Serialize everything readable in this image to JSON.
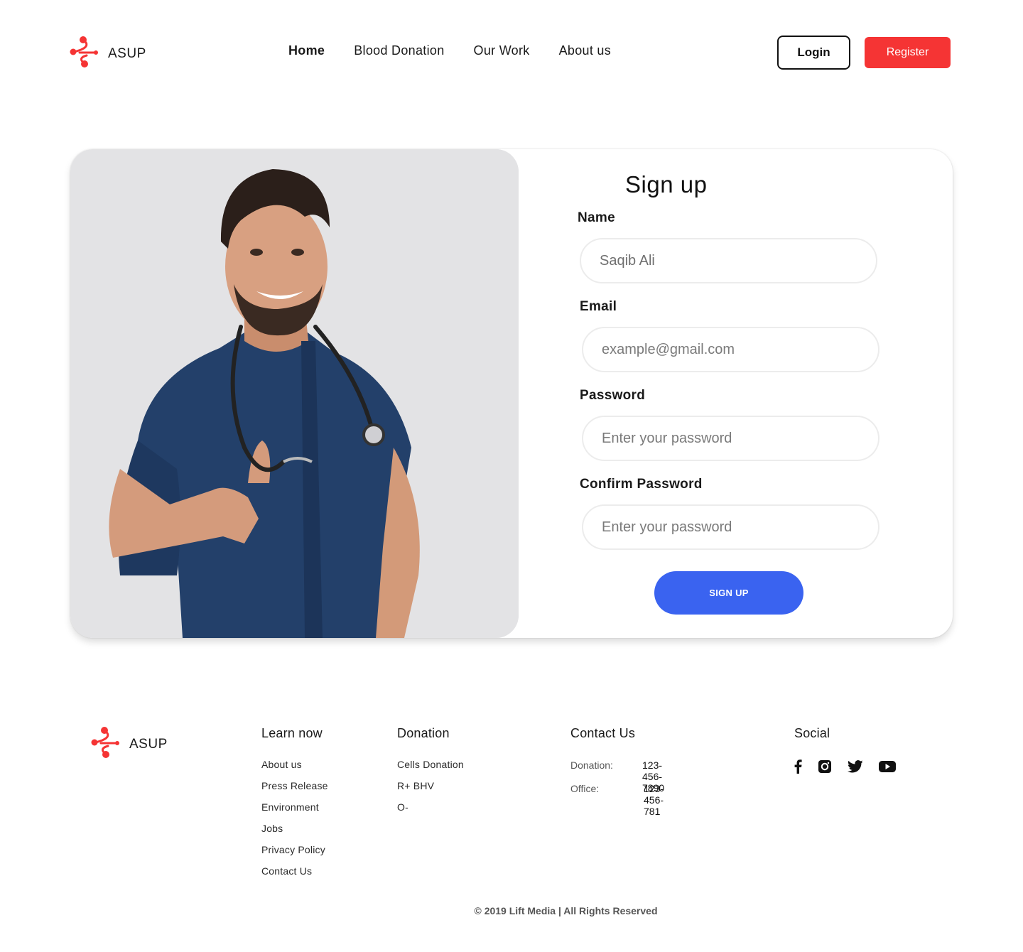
{
  "brand": {
    "name": "ASUP",
    "color": "#f53434"
  },
  "nav": {
    "items": [
      {
        "label": "Home",
        "active": true
      },
      {
        "label": "Blood Donation",
        "active": false
      },
      {
        "label": "Our Work",
        "active": false
      },
      {
        "label": "About us",
        "active": false
      }
    ]
  },
  "header": {
    "login_label": "Login",
    "register_label": "Register"
  },
  "signup": {
    "title": "Sign up",
    "name_label": "Name",
    "name_value": "Saqib Ali",
    "email_label": "Email",
    "email_placeholder": "example@gmail.com",
    "password_label": "Password",
    "password_placeholder": "Enter your password",
    "confirm_label": "Confirm Password",
    "confirm_placeholder": "Enter your password",
    "submit_label": "SIGN UP",
    "submit_color": "#3a63f0"
  },
  "footer": {
    "brand": "ASUP",
    "learn": {
      "title": "Learn now",
      "links": [
        "About us",
        "Press Release",
        "Environment",
        "Jobs",
        "Privacy Policy",
        "Contact Us"
      ]
    },
    "donation": {
      "title": "Donation",
      "links": [
        "Cells Donation",
        "R+ BHV",
        "O-"
      ]
    },
    "contact": {
      "title": "Contact Us",
      "donation_key": "Donation:",
      "donation_value": "123-456-7890",
      "office_key": "Office:",
      "office_value": "123-456-781"
    },
    "social": {
      "title": "Social",
      "icons": [
        "facebook-icon",
        "instagram-icon",
        "twitter-icon",
        "youtube-icon"
      ]
    },
    "copyright": "© 2019 Lift Media | All Rights Reserved"
  }
}
